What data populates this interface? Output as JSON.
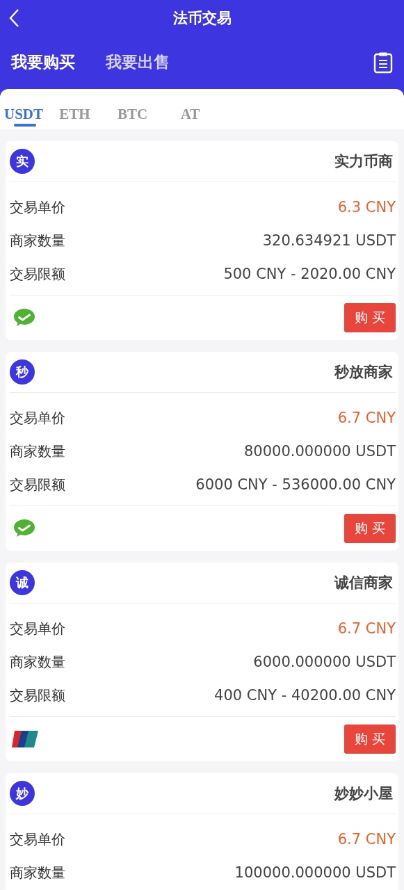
{
  "header": {
    "title": "法币交易"
  },
  "trade_tabs": [
    {
      "label": "我要购买",
      "selected": true
    },
    {
      "label": "我要出售",
      "selected": false
    }
  ],
  "coin_tabs": [
    {
      "label": "USDT",
      "selected": true
    },
    {
      "label": "ETH",
      "selected": false
    },
    {
      "label": "BTC",
      "selected": false
    },
    {
      "label": "AT",
      "selected": false
    }
  ],
  "offers": [
    {
      "badge": "实",
      "merchant": "实力币商",
      "rows": [
        {
          "label": "交易单价",
          "value": "6.3 CNY",
          "kind": "price"
        },
        {
          "label": "商家数量",
          "value": "320.634921 USDT",
          "kind": "plain"
        },
        {
          "label": "交易限额",
          "value": "500 CNY - 2020.00 CNY",
          "kind": "plain"
        }
      ],
      "payment": {
        "kind": "wechat"
      },
      "button": "购 买"
    },
    {
      "badge": "秒",
      "merchant": "秒放商家",
      "rows": [
        {
          "label": "交易单价",
          "value": "6.7 CNY",
          "kind": "price"
        },
        {
          "label": "商家数量",
          "value": "80000.000000 USDT",
          "kind": "plain"
        },
        {
          "label": "交易限额",
          "value": "6000 CNY - 536000.00 CNY",
          "kind": "plain"
        }
      ],
      "payment": {
        "kind": "wechat"
      },
      "button": "购 买"
    },
    {
      "badge": "诚",
      "merchant": "诚信商家",
      "rows": [
        {
          "label": "交易单价",
          "value": "6.7 CNY",
          "kind": "price"
        },
        {
          "label": "商家数量",
          "value": "6000.000000 USDT",
          "kind": "plain"
        },
        {
          "label": "交易限额",
          "value": "400 CNY - 40200.00 CNY",
          "kind": "plain"
        }
      ],
      "payment": {
        "kind": "unionpay"
      },
      "button": "购 买"
    },
    {
      "badge": "妙",
      "merchant": "妙妙小屋",
      "rows": [
        {
          "label": "交易单价",
          "value": "6.7 CNY",
          "kind": "price"
        },
        {
          "label": "商家数量",
          "value": "100000.000000 USDT",
          "kind": "plain"
        }
      ]
    }
  ]
}
